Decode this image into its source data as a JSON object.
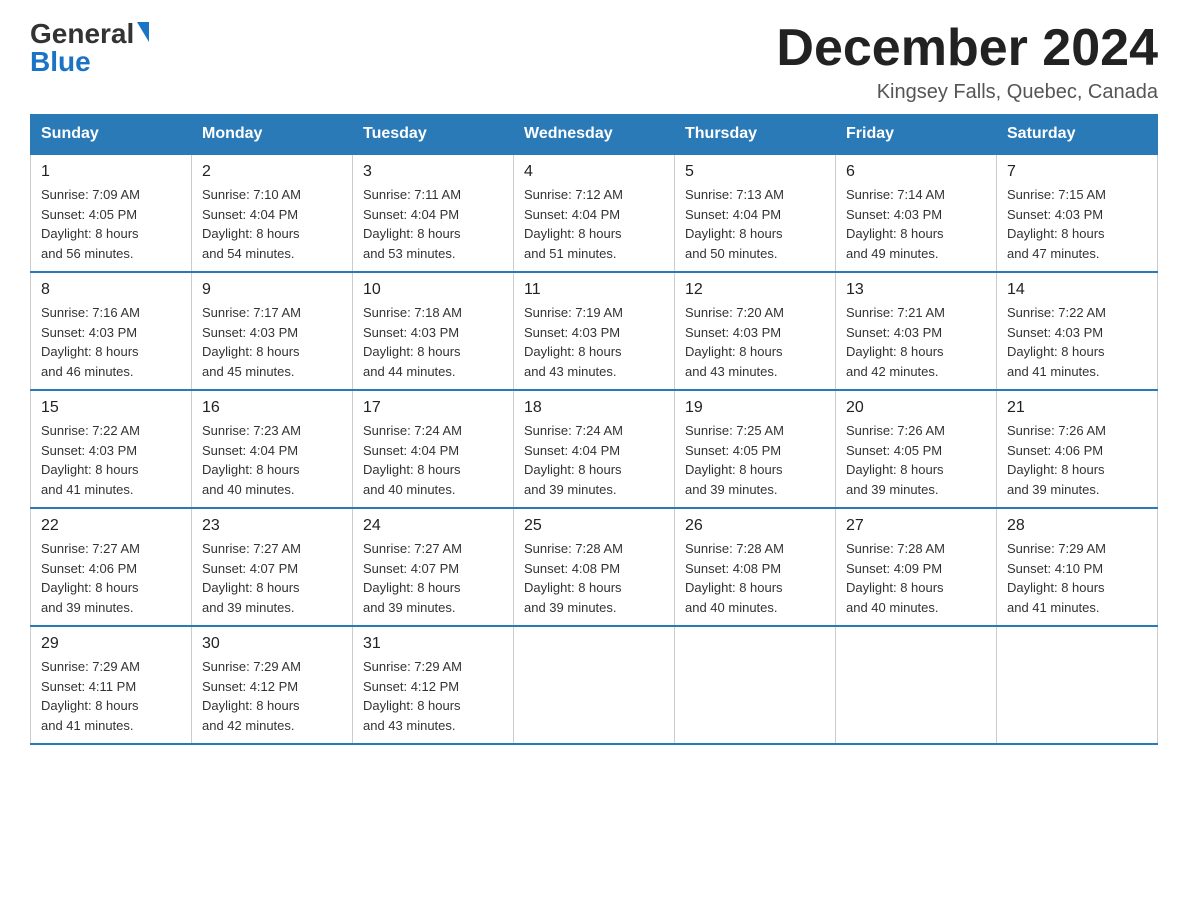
{
  "logo": {
    "general": "General",
    "blue": "Blue"
  },
  "title": "December 2024",
  "location": "Kingsey Falls, Quebec, Canada",
  "headers": [
    "Sunday",
    "Monday",
    "Tuesday",
    "Wednesday",
    "Thursday",
    "Friday",
    "Saturday"
  ],
  "weeks": [
    [
      {
        "day": "1",
        "info": "Sunrise: 7:09 AM\nSunset: 4:05 PM\nDaylight: 8 hours\nand 56 minutes."
      },
      {
        "day": "2",
        "info": "Sunrise: 7:10 AM\nSunset: 4:04 PM\nDaylight: 8 hours\nand 54 minutes."
      },
      {
        "day": "3",
        "info": "Sunrise: 7:11 AM\nSunset: 4:04 PM\nDaylight: 8 hours\nand 53 minutes."
      },
      {
        "day": "4",
        "info": "Sunrise: 7:12 AM\nSunset: 4:04 PM\nDaylight: 8 hours\nand 51 minutes."
      },
      {
        "day": "5",
        "info": "Sunrise: 7:13 AM\nSunset: 4:04 PM\nDaylight: 8 hours\nand 50 minutes."
      },
      {
        "day": "6",
        "info": "Sunrise: 7:14 AM\nSunset: 4:03 PM\nDaylight: 8 hours\nand 49 minutes."
      },
      {
        "day": "7",
        "info": "Sunrise: 7:15 AM\nSunset: 4:03 PM\nDaylight: 8 hours\nand 47 minutes."
      }
    ],
    [
      {
        "day": "8",
        "info": "Sunrise: 7:16 AM\nSunset: 4:03 PM\nDaylight: 8 hours\nand 46 minutes."
      },
      {
        "day": "9",
        "info": "Sunrise: 7:17 AM\nSunset: 4:03 PM\nDaylight: 8 hours\nand 45 minutes."
      },
      {
        "day": "10",
        "info": "Sunrise: 7:18 AM\nSunset: 4:03 PM\nDaylight: 8 hours\nand 44 minutes."
      },
      {
        "day": "11",
        "info": "Sunrise: 7:19 AM\nSunset: 4:03 PM\nDaylight: 8 hours\nand 43 minutes."
      },
      {
        "day": "12",
        "info": "Sunrise: 7:20 AM\nSunset: 4:03 PM\nDaylight: 8 hours\nand 43 minutes."
      },
      {
        "day": "13",
        "info": "Sunrise: 7:21 AM\nSunset: 4:03 PM\nDaylight: 8 hours\nand 42 minutes."
      },
      {
        "day": "14",
        "info": "Sunrise: 7:22 AM\nSunset: 4:03 PM\nDaylight: 8 hours\nand 41 minutes."
      }
    ],
    [
      {
        "day": "15",
        "info": "Sunrise: 7:22 AM\nSunset: 4:03 PM\nDaylight: 8 hours\nand 41 minutes."
      },
      {
        "day": "16",
        "info": "Sunrise: 7:23 AM\nSunset: 4:04 PM\nDaylight: 8 hours\nand 40 minutes."
      },
      {
        "day": "17",
        "info": "Sunrise: 7:24 AM\nSunset: 4:04 PM\nDaylight: 8 hours\nand 40 minutes."
      },
      {
        "day": "18",
        "info": "Sunrise: 7:24 AM\nSunset: 4:04 PM\nDaylight: 8 hours\nand 39 minutes."
      },
      {
        "day": "19",
        "info": "Sunrise: 7:25 AM\nSunset: 4:05 PM\nDaylight: 8 hours\nand 39 minutes."
      },
      {
        "day": "20",
        "info": "Sunrise: 7:26 AM\nSunset: 4:05 PM\nDaylight: 8 hours\nand 39 minutes."
      },
      {
        "day": "21",
        "info": "Sunrise: 7:26 AM\nSunset: 4:06 PM\nDaylight: 8 hours\nand 39 minutes."
      }
    ],
    [
      {
        "day": "22",
        "info": "Sunrise: 7:27 AM\nSunset: 4:06 PM\nDaylight: 8 hours\nand 39 minutes."
      },
      {
        "day": "23",
        "info": "Sunrise: 7:27 AM\nSunset: 4:07 PM\nDaylight: 8 hours\nand 39 minutes."
      },
      {
        "day": "24",
        "info": "Sunrise: 7:27 AM\nSunset: 4:07 PM\nDaylight: 8 hours\nand 39 minutes."
      },
      {
        "day": "25",
        "info": "Sunrise: 7:28 AM\nSunset: 4:08 PM\nDaylight: 8 hours\nand 39 minutes."
      },
      {
        "day": "26",
        "info": "Sunrise: 7:28 AM\nSunset: 4:08 PM\nDaylight: 8 hours\nand 40 minutes."
      },
      {
        "day": "27",
        "info": "Sunrise: 7:28 AM\nSunset: 4:09 PM\nDaylight: 8 hours\nand 40 minutes."
      },
      {
        "day": "28",
        "info": "Sunrise: 7:29 AM\nSunset: 4:10 PM\nDaylight: 8 hours\nand 41 minutes."
      }
    ],
    [
      {
        "day": "29",
        "info": "Sunrise: 7:29 AM\nSunset: 4:11 PM\nDaylight: 8 hours\nand 41 minutes."
      },
      {
        "day": "30",
        "info": "Sunrise: 7:29 AM\nSunset: 4:12 PM\nDaylight: 8 hours\nand 42 minutes."
      },
      {
        "day": "31",
        "info": "Sunrise: 7:29 AM\nSunset: 4:12 PM\nDaylight: 8 hours\nand 43 minutes."
      },
      {
        "day": "",
        "info": ""
      },
      {
        "day": "",
        "info": ""
      },
      {
        "day": "",
        "info": ""
      },
      {
        "day": "",
        "info": ""
      }
    ]
  ]
}
